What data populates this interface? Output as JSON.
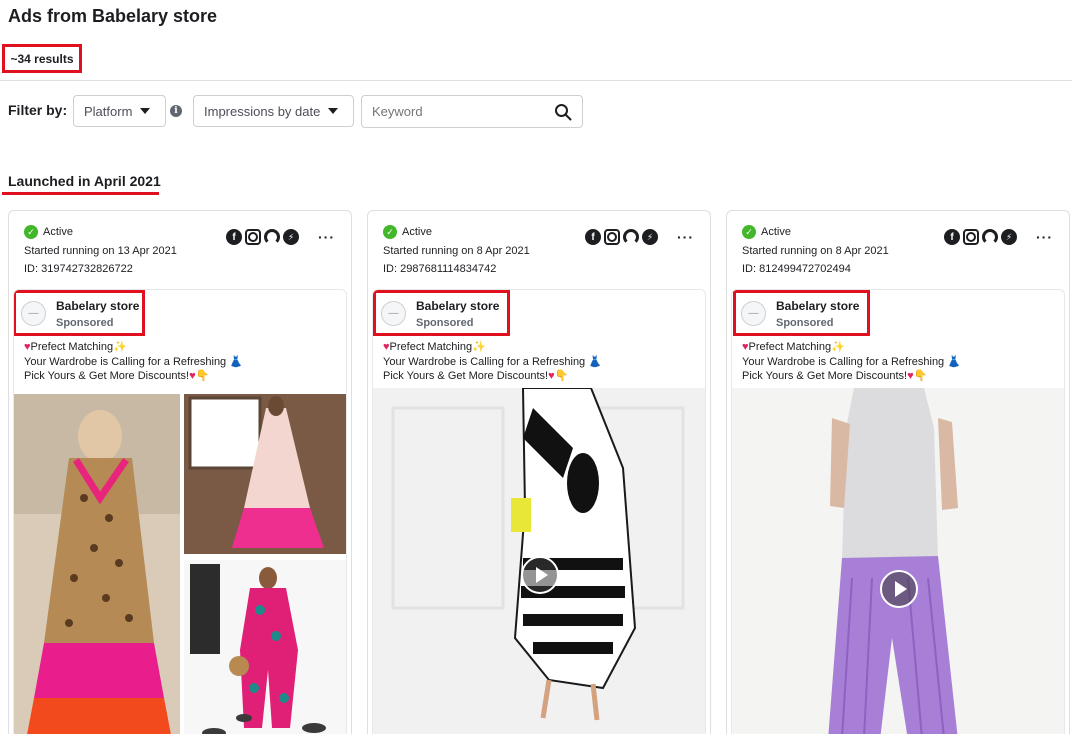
{
  "header": {
    "title": "Ads from Babelary store",
    "results": "~34 results"
  },
  "filters": {
    "label": "Filter by:",
    "platform": "Platform",
    "impressions": "Impressions by date",
    "keyword_placeholder": "Keyword"
  },
  "section": {
    "heading": "Launched in April 2021"
  },
  "ad_cards": [
    {
      "status": "Active",
      "started": "Started running on 13 Apr 2021",
      "id": "ID: 319742732826722",
      "advertiser": "Babelary store",
      "sponsored": "Sponsored",
      "text_line1": "Prefect Matching",
      "text_line2": "Your Wardrobe is Calling for a Refreshing",
      "text_line3": "Pick Yours & Get More Discounts!",
      "media_type": "image-collage"
    },
    {
      "status": "Active",
      "started": "Started running on 8 Apr 2021",
      "id": "ID: 2987681114834742",
      "advertiser": "Babelary store",
      "sponsored": "Sponsored",
      "text_line1": "Prefect Matching",
      "text_line2": "Your Wardrobe is Calling for a Refreshing",
      "text_line3": "Pick Yours & Get More Discounts!",
      "media_type": "video"
    },
    {
      "status": "Active",
      "started": "Started running on 8 Apr 2021",
      "id": "ID: 812499472702494",
      "advertiser": "Babelary store",
      "sponsored": "Sponsored",
      "text_line1": "Prefect Matching",
      "text_line2": "Your Wardrobe is Calling for a Refreshing",
      "text_line3": "Pick Yours & Get More Discounts!",
      "media_type": "video"
    }
  ],
  "icons": {
    "status": "check-circle-icon",
    "platforms": [
      "facebook-icon",
      "instagram-icon",
      "audience-network-icon",
      "messenger-icon"
    ],
    "more": "more-options-icon",
    "search": "search-icon",
    "info": "info-icon",
    "play": "play-icon"
  },
  "colors": {
    "highlight": "#e0101e",
    "active": "#42b72a"
  }
}
